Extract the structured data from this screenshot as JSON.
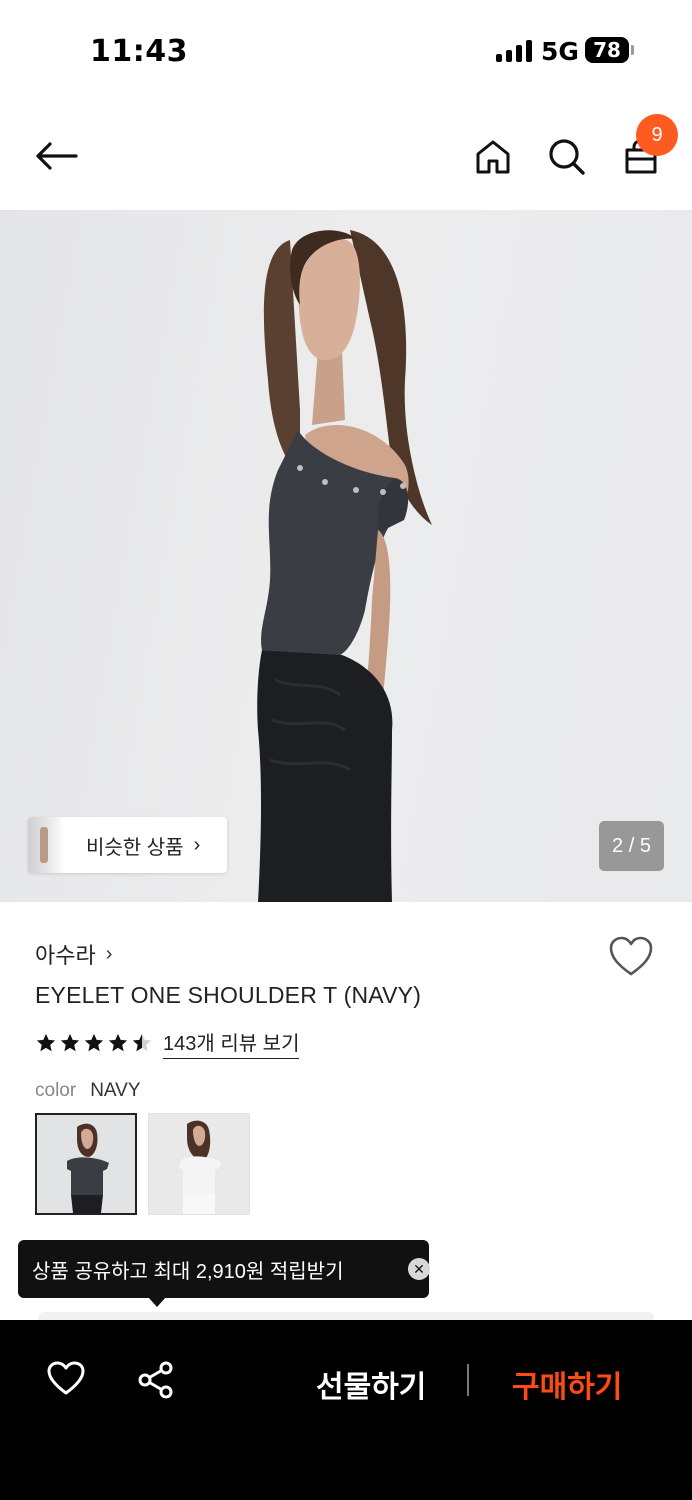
{
  "status_bar": {
    "time": "11:43",
    "network": "5G",
    "battery": "78"
  },
  "nav": {
    "cart_count": "9"
  },
  "gallery": {
    "similar_label": "비슷한 상품",
    "page_indicator": "2 / 5"
  },
  "product": {
    "brand": "아수라",
    "title": "EYELET ONE SHOULDER T (NAVY)",
    "rating": 4.5,
    "review_link": "143개 리뷰 보기",
    "color_label": "color",
    "color_value": "NAVY",
    "colors": [
      "navy",
      "white"
    ]
  },
  "tooltip": {
    "text": "상품 공유하고 최대 2,910원 적립받기"
  },
  "bottom_bar": {
    "gift_label": "선물하기",
    "buy_label": "구매하기"
  },
  "colors": {
    "accent": "#ff5a1f",
    "buy": "#ff4a14",
    "bottom_bar_bg": "#000000"
  }
}
